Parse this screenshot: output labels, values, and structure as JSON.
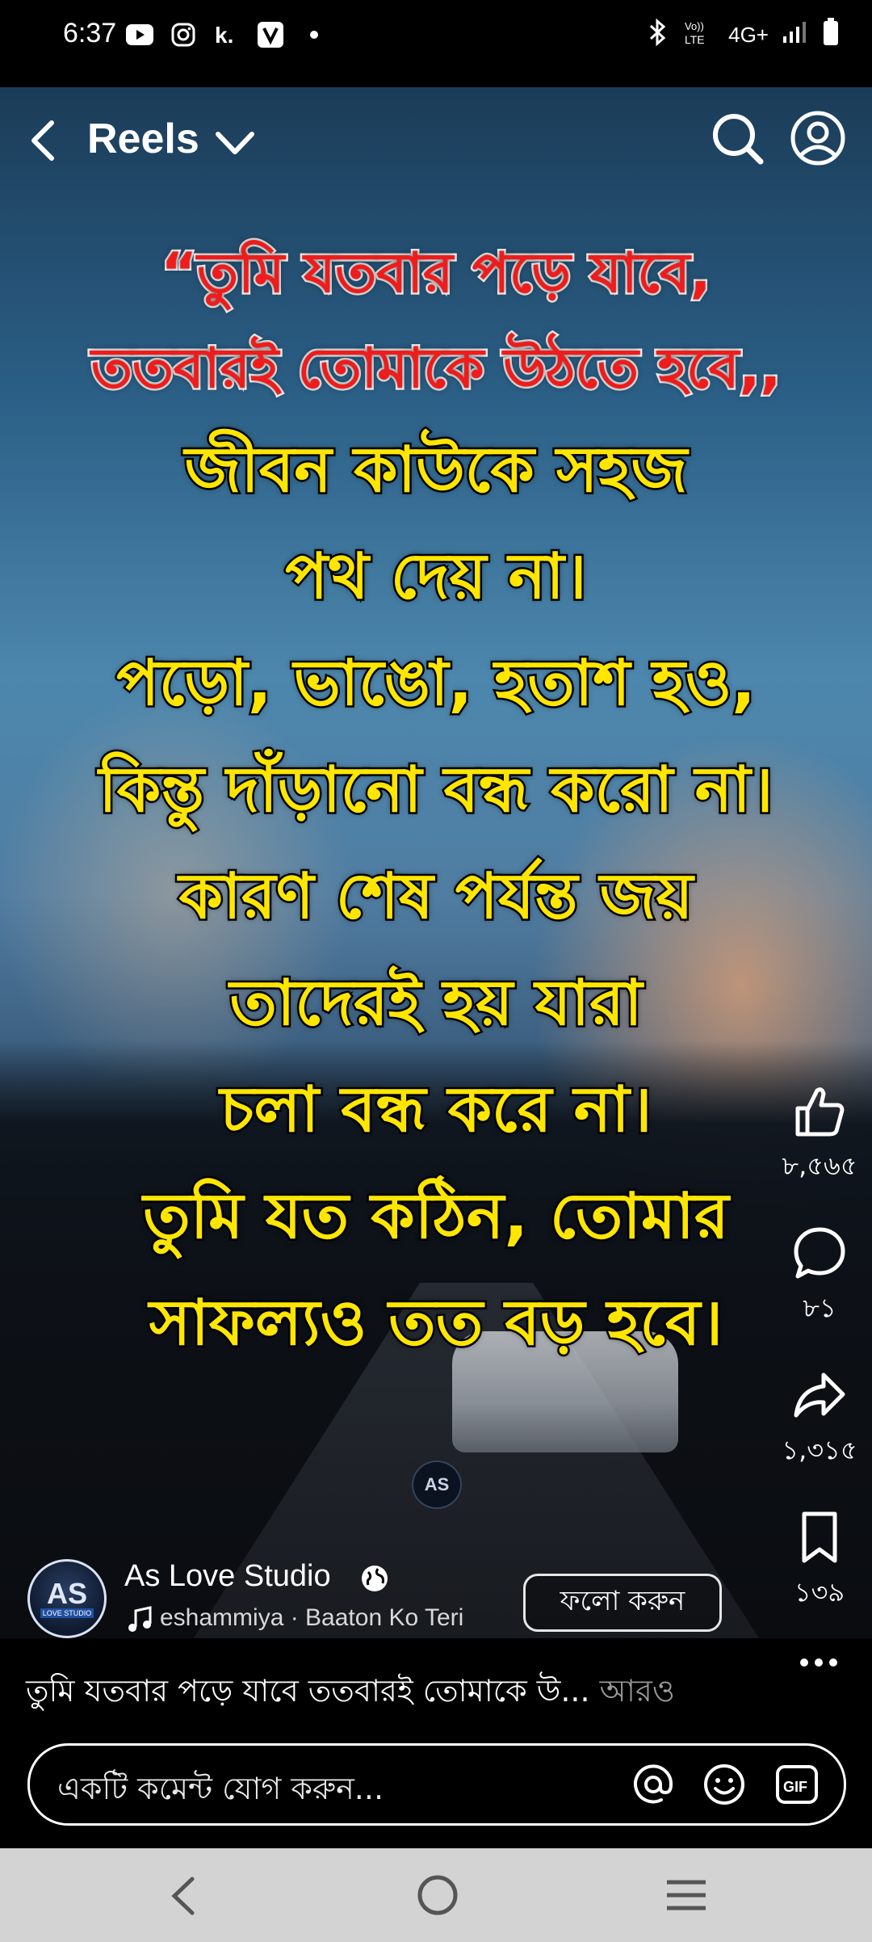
{
  "status_bar": {
    "time": "6:37",
    "left_icons": [
      "youtube-icon",
      "instagram-icon",
      "k-app-icon",
      "v-app-icon",
      "dot-icon"
    ],
    "network": "4G+",
    "right_icons": [
      "bluetooth-icon",
      "volte-icon",
      "signal-icon",
      "battery-icon"
    ]
  },
  "header": {
    "title": "Reels",
    "icons": [
      "back-icon",
      "chevron-down-icon",
      "search-icon",
      "profile-icon"
    ]
  },
  "reel": {
    "quote_lines": [
      "“তুমি যতবার পড়ে যাবে,",
      "ততবারই তোমাকে উঠতে হবে,,",
      "জীবন কাউকে সহজ",
      "পথ দেয় না।",
      "পড়ো, ভাঙো, হতাশ হও,",
      "কিন্তু দাঁড়ানো বন্ধ করো না।",
      "কারণ শেষ পর্যন্ত জয়",
      "তাদেরই হয় যারা",
      "চলা বন্ধ করে না।",
      "তুমি যত কঠিন, তোমার",
      "সাফল্যও তত বড় হবে।"
    ],
    "quote_colors": {
      "red": "#ee1c1c",
      "yellow": "#ffe600"
    },
    "watermark": "AS"
  },
  "actions": {
    "like_count": "৮,৫৬৫",
    "comment_count": "৮১",
    "share_count": "১,৩১৫",
    "save_count": "১৩৯"
  },
  "author": {
    "avatar_text": "AS",
    "avatar_subtext": "LOVE STUDIO",
    "name": "As Love Studio",
    "song": "eshammiya · Baaton Ko Teri",
    "follow_label": "ফলো করুন"
  },
  "caption": {
    "text": "তুমি যতবার পড়ে যাবে ততবারই তোমাকে উ...",
    "more_label": "আরও"
  },
  "comment": {
    "placeholder": "একটি কমেন্ট যোগ করুন...",
    "icons": [
      "at-icon",
      "emoji-icon",
      "gif-icon"
    ]
  },
  "navbar": {
    "icons": [
      "nav-back-icon",
      "nav-home-icon",
      "nav-recent-icon"
    ]
  }
}
